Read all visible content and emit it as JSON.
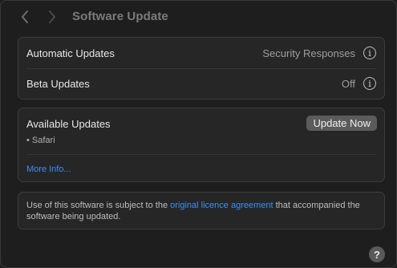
{
  "window": {
    "title": "Software Update",
    "nav_back_icon": "chevron-left-icon",
    "nav_forward_icon": "chevron-right-icon"
  },
  "settings": {
    "automatic_updates": {
      "label": "Automatic Updates",
      "value": "Security Responses",
      "info_icon": "info-icon"
    },
    "beta_updates": {
      "label": "Beta Updates",
      "value": "Off",
      "info_icon": "info-icon"
    }
  },
  "available_updates": {
    "title": "Available Updates",
    "update_button": "Update Now",
    "items": [
      "• Safari"
    ],
    "more_info": "More Info..."
  },
  "licence": {
    "text_before": "Use of this software is subject to the ",
    "link": "original licence agreement",
    "text_after": " that accompanied the software being updated."
  },
  "help": {
    "label": "?",
    "icon": "help-icon"
  },
  "colors": {
    "background": "#1e1e1e",
    "group_background": "#262626",
    "link": "#3d8ff5",
    "button": "#5b5b5b"
  }
}
